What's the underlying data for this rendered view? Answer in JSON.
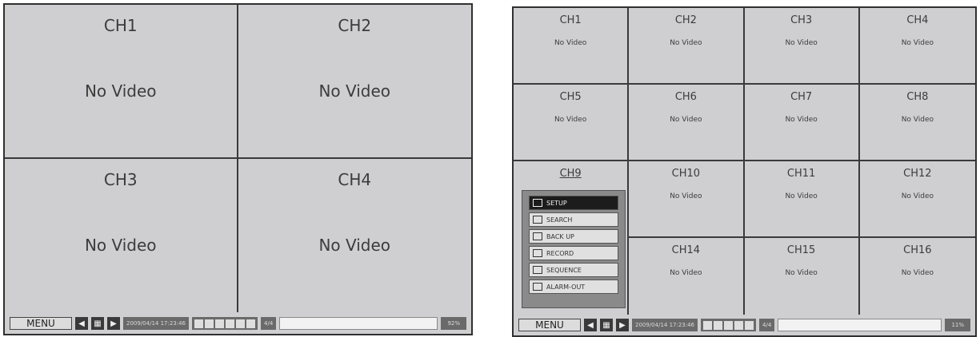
{
  "left": {
    "cells": [
      {
        "ch": "CH1",
        "status": "No Video"
      },
      {
        "ch": "CH2",
        "status": "No Video"
      },
      {
        "ch": "CH3",
        "status": "No Video"
      },
      {
        "ch": "CH4",
        "status": "No Video"
      }
    ],
    "statusbar": {
      "menu_label": "MENU",
      "datetime": "2009/04/14 17:23:46",
      "channels": "4/4",
      "hdd": "92%"
    }
  },
  "right": {
    "cells": [
      {
        "ch": "CH1",
        "status": "No Video"
      },
      {
        "ch": "CH2",
        "status": "No Video"
      },
      {
        "ch": "CH3",
        "status": "No Video"
      },
      {
        "ch": "CH4",
        "status": "No Video"
      },
      {
        "ch": "CH5",
        "status": "No Video"
      },
      {
        "ch": "CH6",
        "status": "No Video"
      },
      {
        "ch": "CH7",
        "status": "No Video"
      },
      {
        "ch": "CH8",
        "status": "No Video"
      },
      {
        "ch": "CH9",
        "status": ""
      },
      {
        "ch": "CH10",
        "status": "No Video"
      },
      {
        "ch": "CH11",
        "status": "No Video"
      },
      {
        "ch": "CH12",
        "status": "No Video"
      },
      {
        "ch": "",
        "status": ""
      },
      {
        "ch": "CH14",
        "status": "No Video"
      },
      {
        "ch": "CH15",
        "status": "No Video"
      },
      {
        "ch": "CH16",
        "status": "No Video"
      }
    ],
    "popup_menu": {
      "items": [
        {
          "label": "SETUP",
          "icon": "setup-icon"
        },
        {
          "label": "SEARCH",
          "icon": "search-icon"
        },
        {
          "label": "BACK UP",
          "icon": "backup-icon"
        },
        {
          "label": "RECORD",
          "icon": "record-icon"
        },
        {
          "label": "SEQUENCE",
          "icon": "sequence-icon"
        },
        {
          "label": "ALARM-OUT",
          "icon": "alarm-out-icon"
        }
      ],
      "selected": "SETUP"
    },
    "statusbar": {
      "menu_label": "MENU",
      "datetime": "2009/04/14 17:23:46",
      "channels": "4/4",
      "hdd": "11%"
    }
  },
  "colors": {
    "screen_bg": "#cfcfd1",
    "grid_line": "#3a3a3a",
    "popup_bg": "#8a8a8a",
    "popup_active": "#1c1c1c"
  }
}
